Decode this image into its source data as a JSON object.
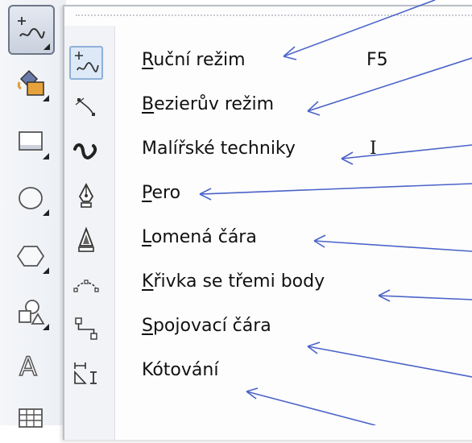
{
  "toolbox": {
    "tools": [
      {
        "name": "freehand-tool-button",
        "icon": "freehand-curve-icon",
        "active": true
      },
      {
        "name": "smart-fill-tool-button",
        "icon": "smart-fill-icon"
      },
      {
        "name": "rectangle-tool-button",
        "icon": "rectangle-icon"
      },
      {
        "name": "ellipse-tool-button",
        "icon": "ellipse-icon"
      },
      {
        "name": "polygon-tool-button",
        "icon": "polygon-icon"
      },
      {
        "name": "basic-shapes-tool-button",
        "icon": "basic-shapes-icon"
      },
      {
        "name": "text-tool-button",
        "icon": "text-tool-icon"
      },
      {
        "name": "table-tool-button",
        "icon": "table-icon"
      }
    ]
  },
  "menu": {
    "items": [
      {
        "pre": "",
        "u": "R",
        "post": "uční režim",
        "shortcut": "F5",
        "icon": "freehand-icon",
        "checked": true
      },
      {
        "pre": "",
        "u": "B",
        "post": "ezierův režim",
        "shortcut": "",
        "icon": "bezier-icon"
      },
      {
        "pre": "Malířské techniky",
        "u": "",
        "post": "",
        "shortcut": "I",
        "icon": "artistic-media-icon"
      },
      {
        "pre": "",
        "u": "P",
        "post": "ero",
        "shortcut": "",
        "icon": "pen-nib-icon"
      },
      {
        "pre": "",
        "u": "L",
        "post": "omená čára",
        "shortcut": "",
        "icon": "polyline-icon"
      },
      {
        "pre": "",
        "u": "K",
        "post": "řivka se třemi body",
        "shortcut": "",
        "icon": "three-point-curve-icon"
      },
      {
        "pre": "",
        "u": "S",
        "post": "pojovací čára",
        "shortcut": "",
        "icon": "connector-line-icon"
      },
      {
        "pre": "Kótování",
        "u": "",
        "post": "",
        "shortcut": "",
        "icon": "dimension-icon"
      }
    ]
  },
  "colors": {
    "arrow": "#4a63c9",
    "menu_border": "#b9bec7",
    "checked_bg": "#dde9f7",
    "checked_border": "#8fb0d9"
  }
}
